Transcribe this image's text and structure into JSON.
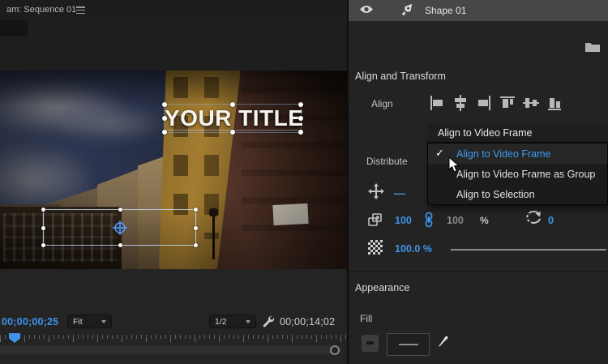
{
  "colors": {
    "accent_blue": "#3f93e8",
    "panel_bg": "#232323",
    "selected_row_bg": "#474747"
  },
  "program_monitor": {
    "tab_label": "am: Sequence 01",
    "title_overlay_text": "YOUR TITLE",
    "transport": {
      "current_timecode": "00;00;00;25",
      "zoom_level": "Fit",
      "playback_resolution": "1/2",
      "duration_timecode": "00;00;14;02"
    }
  },
  "essential_graphics": {
    "layer": {
      "name": "Shape 01"
    },
    "align_section": {
      "header": "Align and Transform",
      "align_label": "Align",
      "align_buttons": [
        "align-left",
        "align-center-horizontal",
        "align-right",
        "align-top",
        "align-center-vertical",
        "align-bottom"
      ],
      "dropdown": {
        "value": "Align to Video Frame",
        "check_glyph": "✓",
        "options": [
          {
            "label": "Align to Video Frame",
            "checked": true
          },
          {
            "label": "Align to Video Frame as Group",
            "checked": false
          },
          {
            "label": "Align to Selection",
            "checked": false
          }
        ]
      },
      "distribute_label": "Distribute",
      "position_value": "—",
      "scale": {
        "x": "100",
        "y": "100",
        "unit": "%",
        "linked": true
      },
      "rotation_value": "0",
      "opacity_value": "100.0 %"
    },
    "appearance": {
      "header": "Appearance",
      "fill_label": "Fill"
    }
  }
}
